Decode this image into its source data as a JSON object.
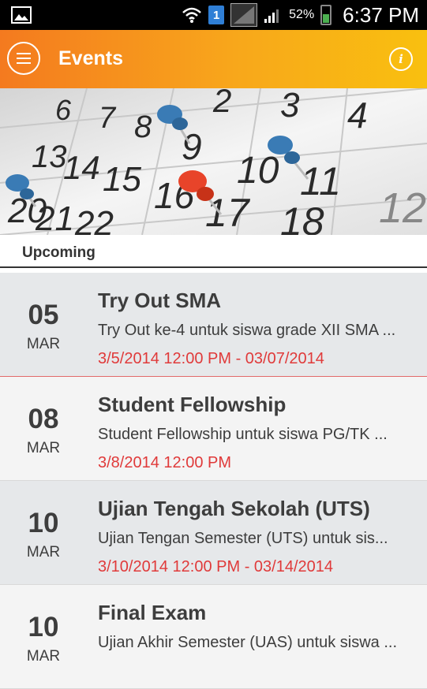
{
  "status_bar": {
    "battery": "52%",
    "time": "6:37 PM",
    "sim": "1",
    "icons": [
      "image-icon",
      "wifi-icon",
      "sim-icon",
      "signal-icon",
      "signal-icon",
      "battery-icon"
    ]
  },
  "app_bar": {
    "title": "Events",
    "menu_icon": "hamburger-menu-icon",
    "info_icon": "info-icon",
    "info_glyph": "i",
    "gradient": [
      "#f47a1f",
      "#f9c00f"
    ]
  },
  "section": {
    "title": "Upcoming"
  },
  "events": [
    {
      "day": "05",
      "month": "MAR",
      "title": "Try Out SMA",
      "description": "Try Out ke-4 untuk siswa grade XII SMA ...",
      "time": "3/5/2014 12:00 PM - 03/07/2014"
    },
    {
      "day": "08",
      "month": "MAR",
      "title": "Student Fellowship",
      "description": "Student Fellowship untuk siswa PG/TK ...",
      "time": "3/8/2014 12:00 PM"
    },
    {
      "day": "10",
      "month": "MAR",
      "title": "Ujian Tengah Sekolah (UTS)",
      "description": "Ujian Tengan Semester (UTS) untuk sis...",
      "time": "3/10/2014 12:00 PM - 03/14/2014"
    },
    {
      "day": "10",
      "month": "MAR",
      "title": "Final Exam",
      "description": "Ujian Akhir Semester (UAS) untuk siswa ...",
      "time": ""
    }
  ],
  "colors": {
    "accent": "#f8a71b",
    "time_text": "#e03a3a"
  }
}
